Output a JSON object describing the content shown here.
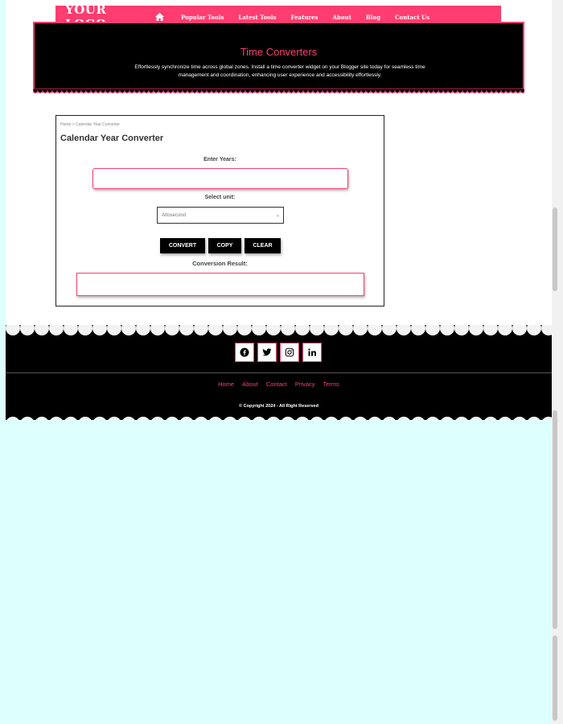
{
  "nav": {
    "logo": "YOUR LOGO",
    "links": [
      "Popular Tools",
      "Latest Tools",
      "Features",
      "About",
      "Blog",
      "Contact Us"
    ]
  },
  "hero": {
    "title": "Time Converters",
    "description": "Effortlessly synchronize time across global zones. Install a time converter widget on your Blogger site today for seamless time management and coordination, enhancing user experience and accessibility effortlessly."
  },
  "converter": {
    "breadcrumb_home": "Home",
    "breadcrumb_sep": ">",
    "breadcrumb_current": "Calendar Year Converter",
    "title": "Calendar Year Converter",
    "years_label": "Enter Years:",
    "years_value": "",
    "unit_label": "Select unit:",
    "unit_selected": "Attosecond",
    "convert": "CONVERT",
    "copy": "COPY",
    "clear": "CLEAR",
    "result_label": "Conversion Result:",
    "result_value": ""
  },
  "footer": {
    "social": [
      "facebook-icon",
      "twitter-icon",
      "instagram-icon",
      "linkedin-icon"
    ],
    "links": [
      "Home",
      "About",
      "Contact",
      "Privacy",
      "Terms"
    ],
    "copyright": "© Copyright 2024 - All Right Reserved"
  },
  "colors": {
    "accent": "#ff3d70",
    "dark": "#000000",
    "page_bg": "#ddfffe"
  }
}
